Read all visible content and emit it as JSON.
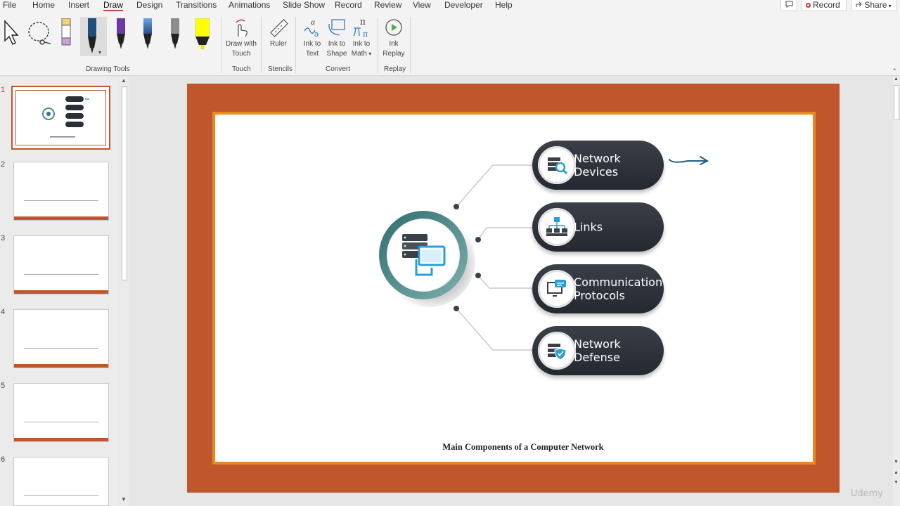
{
  "menu": {
    "tabs": [
      "File",
      "Home",
      "Insert",
      "Draw",
      "Design",
      "Transitions",
      "Animations",
      "Slide Show",
      "Record",
      "Review",
      "View",
      "Developer",
      "Help"
    ],
    "active_tab": "Draw",
    "record_button": "Record",
    "share_button": "Share"
  },
  "ribbon": {
    "draw_with_touch": "Draw with Touch",
    "ruler": "Ruler",
    "ink_to_text": "Ink to Text",
    "ink_to_shape": "Ink to Shape",
    "ink_to_math": "Ink to Math",
    "ink_replay": "Ink Replay",
    "groups": {
      "drawing_tools": "Drawing Tools",
      "touch": "Touch",
      "stencils": "Stencils",
      "convert": "Convert",
      "replay": "Replay"
    },
    "pens": [
      {
        "name": "pencil",
        "color": "#f2d27a"
      },
      {
        "name": "pen-navy",
        "color": "#1f4e79"
      },
      {
        "name": "pen-purple",
        "color": "#6a3aa2"
      },
      {
        "name": "pen-galaxy",
        "color": "#3a6fb0"
      },
      {
        "name": "pen-silver",
        "color": "#8c8c8c"
      },
      {
        "name": "highlighter-yellow",
        "color": "#ffff00"
      }
    ]
  },
  "thumbnails": {
    "numbers": [
      "1",
      "2",
      "3",
      "4",
      "5",
      "6"
    ],
    "active": "1"
  },
  "slide": {
    "items": [
      {
        "label_line1": "Network",
        "label_line2": "Devices",
        "icon": "server-search-icon"
      },
      {
        "label_line1": "Links",
        "label_line2": "",
        "icon": "network-hierarchy-icon"
      },
      {
        "label_line1": "Communication",
        "label_line2": "Protocols",
        "icon": "chat-monitor-icon"
      },
      {
        "label_line1": "Network",
        "label_line2": "Defense",
        "icon": "server-shield-icon"
      }
    ],
    "caption": "Main Components of a Computer Network",
    "colors": {
      "frame": "#c0562b",
      "border": "#e8891e",
      "pill": "#2b2f37",
      "hub_ring": "#4f8a8b",
      "ink": "#1f5d8c"
    }
  },
  "watermark": "Udemy"
}
